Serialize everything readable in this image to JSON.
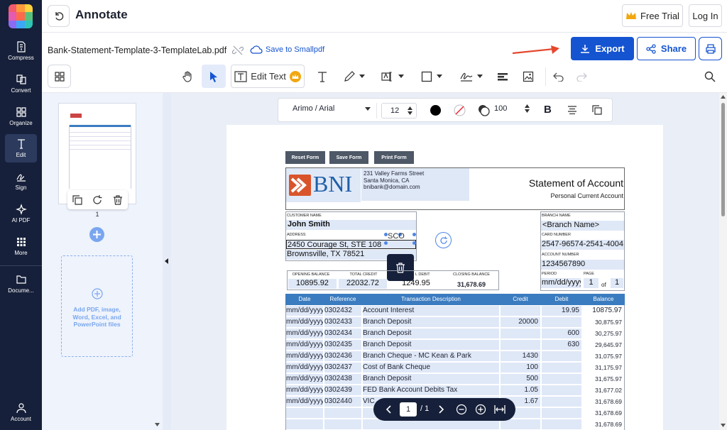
{
  "app": {
    "title": "Annotate",
    "free_trial": "Free Trial",
    "login": "Log In",
    "file_name": "Bank-Statement-Template-3-TemplateLab.pdf",
    "save_link": "Save to Smallpdf",
    "export": "Export",
    "share": "Share",
    "brand_color": "#1554d1"
  },
  "nav": [
    {
      "label": "Compress",
      "icon": "compress-icon"
    },
    {
      "label": "Convert",
      "icon": "convert-icon"
    },
    {
      "label": "Organize",
      "icon": "organize-icon"
    },
    {
      "label": "Edit",
      "icon": "edit-icon"
    },
    {
      "label": "Sign",
      "icon": "sign-icon"
    },
    {
      "label": "AI PDF",
      "icon": "sparkle-icon"
    },
    {
      "label": "More",
      "icon": "grid-icon"
    },
    {
      "label": "Docume...",
      "icon": "folder-icon"
    },
    {
      "label": "Account",
      "icon": "account-icon"
    }
  ],
  "toolbar": {
    "edit_text": "Edit Text",
    "font": "Arimo / Arial",
    "font_size": "12",
    "opacity": "100"
  },
  "thumbs": {
    "page_number": "1",
    "add_files": "Add PDF, image, Word, Excel, and PowerPoint files"
  },
  "pager": {
    "current": "1",
    "total": "/ 1"
  },
  "doc": {
    "buttons": [
      "Reset Form",
      "Save Form",
      "Print Form"
    ],
    "bank": "BNI",
    "address_lines": [
      "231 Valley Farms Street",
      "Santa Monica, CA",
      "bnibank@domain.com"
    ],
    "statement_title": "Statement of Account",
    "statement_sub": "Personal Current Account",
    "customer_name_label": "CUSTOMER NAME",
    "customer_name": "John Smith",
    "address_label": "ADDRESS",
    "address1": "2450 Courage St, STE 108",
    "address2": "Brownsville, TX 78521",
    "branch_name_label": "BRANCH NAME",
    "branch_name": "<Branch Name>",
    "card_label": "CARD NUMBER",
    "card_number": "2547-96574-2541-4004",
    "account_label": "ACCOUNT NUMBER",
    "account_number": "1234567890",
    "period_label": "PERIOD",
    "period": "mm/dd/yyyy",
    "page_label": "PAGE",
    "page_of": "of",
    "page_cur": "1",
    "page_tot": "1",
    "totals": [
      {
        "label": "OPENING BALANCE",
        "value": "10895.92"
      },
      {
        "label": "TOTAL CREDIT",
        "value": "22032.72"
      },
      {
        "label": "L DEBIT",
        "value": "1249.95"
      },
      {
        "label": "CLOSING BALANCE",
        "value": "31,678.69"
      }
    ],
    "cursor_text": "SCO",
    "columns": [
      "Date",
      "Reference",
      "Transaction Description",
      "Credit",
      "Debit",
      "Balance"
    ],
    "rows": [
      {
        "date": "mm/dd/yyyy",
        "ref": "0302432",
        "desc": "Account Interest",
        "credit": "",
        "debit": "19.95",
        "balance": "10875.97"
      },
      {
        "date": "mm/dd/yyyy",
        "ref": "0302433",
        "desc": "Branch Deposit",
        "credit": "20000",
        "debit": "",
        "balance": "30,875.97"
      },
      {
        "date": "mm/dd/yyyy",
        "ref": "0302434",
        "desc": "Branch Deposit",
        "credit": "",
        "debit": "600",
        "balance": "30,275.97"
      },
      {
        "date": "mm/dd/yyyy",
        "ref": "0302435",
        "desc": "Branch Deposit",
        "credit": "",
        "debit": "630",
        "balance": "29,645.97"
      },
      {
        "date": "mm/dd/yyyy",
        "ref": "0302436",
        "desc": "Branch Cheque - MC Kean & Park",
        "credit": "1430",
        "debit": "",
        "balance": "31,075.97"
      },
      {
        "date": "mm/dd/yyyy",
        "ref": "0302437",
        "desc": "Cost of Bank Cheque",
        "credit": "100",
        "debit": "",
        "balance": "31,175.97"
      },
      {
        "date": "mm/dd/yyyy",
        "ref": "0302438",
        "desc": "Branch Deposit",
        "credit": "500",
        "debit": "",
        "balance": "31,675.97"
      },
      {
        "date": "mm/dd/yyyy",
        "ref": "0302439",
        "desc": "FED Bank Account Debits Tax",
        "credit": "1.05",
        "debit": "",
        "balance": "31,677.02"
      },
      {
        "date": "mm/dd/yyyy",
        "ref": "0302440",
        "desc": "VIC",
        "credit": "1.67",
        "debit": "",
        "balance": "31,678.69"
      },
      {
        "date": "",
        "ref": "",
        "desc": "",
        "credit": "",
        "debit": "",
        "balance": "31,678.69"
      },
      {
        "date": "",
        "ref": "",
        "desc": "",
        "credit": "",
        "debit": "",
        "balance": "31,678.69"
      }
    ]
  }
}
